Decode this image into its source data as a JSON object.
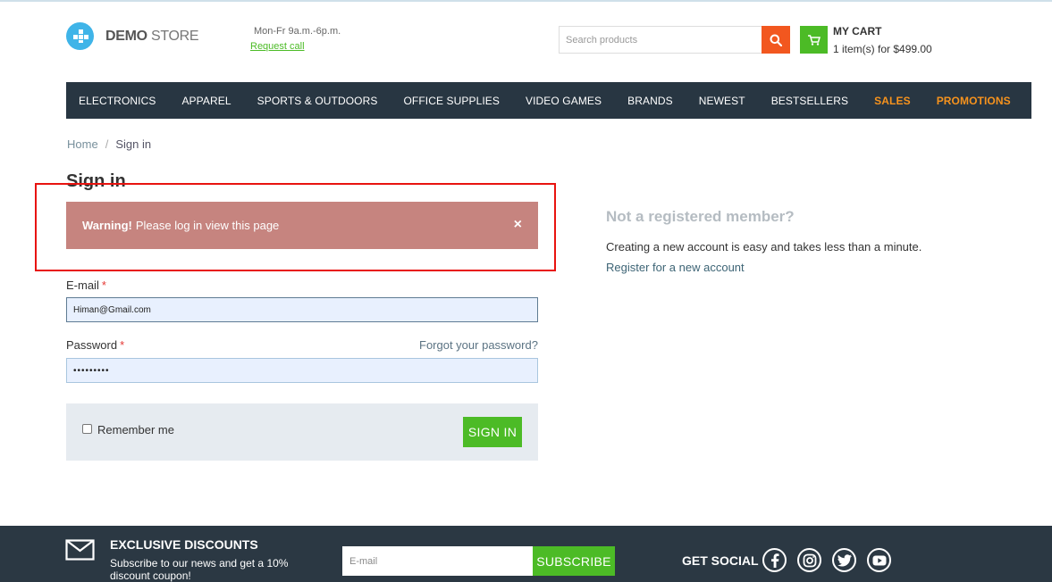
{
  "header": {
    "logo_bold": "DEMO",
    "logo_light": "STORE",
    "hours": "Mon-Fr 9a.m.-6p.m.",
    "request_call": "Request call",
    "search_placeholder": "Search products",
    "cart_title": "MY CART",
    "cart_summary": "1 item(s) for $499.00",
    "icons": {
      "search": "search-icon",
      "cart": "cart-icon"
    }
  },
  "nav": {
    "items": [
      {
        "label": "ELECTRONICS"
      },
      {
        "label": "APPAREL"
      },
      {
        "label": "SPORTS & OUTDOORS"
      },
      {
        "label": "OFFICE SUPPLIES"
      },
      {
        "label": "VIDEO GAMES"
      },
      {
        "label": "BRANDS"
      },
      {
        "label": "NEWEST"
      },
      {
        "label": "BESTSELLERS"
      },
      {
        "label": "SALES"
      },
      {
        "label": "PROMOTIONS"
      }
    ]
  },
  "breadcrumb": {
    "home": "Home",
    "separator": "/",
    "current": "Sign in"
  },
  "page": {
    "title": "Sign in",
    "alert": {
      "strong": "Warning!",
      "message": "Please log in view this page",
      "close": "×"
    }
  },
  "form": {
    "email_label": "E-mail",
    "required_mark": "*",
    "email_value": "Himan@Gmail.com",
    "password_label": "Password",
    "forgot": "Forgot your password?",
    "password_value": "•••••••••",
    "remember": "Remember me",
    "submit": "SIGN IN"
  },
  "register": {
    "title": "Not a registered member?",
    "text": "Creating a new account is easy and takes less than a minute.",
    "link": "Register for a new account"
  },
  "footer": {
    "title": "EXCLUSIVE DISCOUNTS",
    "subtitle": "Subscribe to our news and get a 10% discount coupon!",
    "email_placeholder": "E-mail",
    "subscribe": "SUBSCRIBE",
    "social_title": "GET SOCIAL",
    "social_icons": [
      "facebook-icon",
      "instagram-icon",
      "twitter-icon",
      "youtube-icon"
    ]
  },
  "colors": {
    "accent_green": "#4cbb26",
    "accent_orange": "#f2571f",
    "nav_bg": "#283642",
    "alert_bg": "#c6847f",
    "highlight": "#e8130f"
  }
}
